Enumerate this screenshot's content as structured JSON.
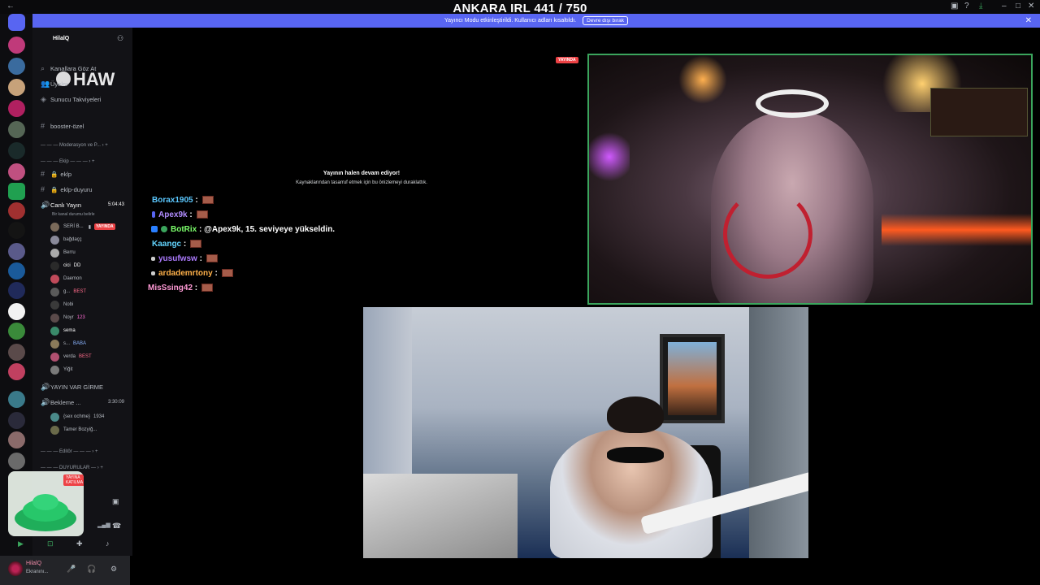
{
  "overlay": {
    "title": "ANKARA IRL 441 / 750"
  },
  "banner": {
    "text": "Yayıncı Modu etkinleştirildi. Kullanıcı adları kısaltıldı.",
    "button": "Devre dışı bırak"
  },
  "server": {
    "name": "HilalQ"
  },
  "sidebar": {
    "browse_channels": "Kanallara Göz At",
    "members": "Üyeler",
    "boosts": "Sunucu Takviyeleri",
    "channels": [
      {
        "name": "booster-özel"
      },
      {
        "name": "eklp"
      },
      {
        "name": "eklp-duyuru"
      }
    ],
    "categories": {
      "moderation": "Moderasyon ve P...",
      "ekip": "Ekip",
      "editor": "Editör",
      "duyurular": "DUYURULAR"
    },
    "voice_live": {
      "name": "Canlı Yayın",
      "time": "5:04:43",
      "status": "Bir kanal durumu belirle"
    },
    "voice_users": [
      {
        "name": "SERİ B...",
        "live": "YAYINDA"
      },
      {
        "name": "bağdaçç"
      },
      {
        "name": "Berru"
      },
      {
        "name": "cici",
        "tag": "DD"
      },
      {
        "name": "Daemon"
      },
      {
        "name": "g...",
        "tag": "BEST"
      },
      {
        "name": "Nobi"
      },
      {
        "name": "Noyr",
        "tag": "123"
      },
      {
        "name": "sema"
      },
      {
        "name": "s...",
        "tag": "BABA"
      },
      {
        "name": "verda",
        "tag": "BEST"
      },
      {
        "name": "Yiğit"
      }
    ],
    "voice_waiting": {
      "category": "YAYIN VAR GİRME",
      "name": "Bekleme ...",
      "time": "3:30:09"
    },
    "waiting_users": [
      {
        "name": "{sex ochme}",
        "tag": "1934"
      },
      {
        "name": "Tamer Bozyiğ..."
      }
    ]
  },
  "widget": {
    "tag": "YAYINA KATILMA"
  },
  "user_panel": {
    "name": "HilalQ",
    "status": "Ekranını..."
  },
  "stream": {
    "msg_title": "Yayının halen devam ediyor!",
    "msg_sub": "Kaynaklarından tasarruf etmek için bu önizlemeyi duraklattık.",
    "live_badge": "YAYINDA"
  },
  "chat": [
    {
      "user": "Borax1905",
      "color": "#5bc8ff"
    },
    {
      "user": "Apex9k",
      "color": "#b18cff"
    },
    {
      "user": "BotRix",
      "color": "#7cff6b",
      "text": "@Apex9k, 15. seviyeye yükseldin."
    },
    {
      "user": "Kaangc",
      "color": "#63d5ff"
    },
    {
      "user": "yusufwsw",
      "color": "#ad7bff"
    },
    {
      "user": "ardademrtony",
      "color": "#ffb14a"
    },
    {
      "user": "MisSsing42",
      "color": "#ff9ad5"
    }
  ]
}
